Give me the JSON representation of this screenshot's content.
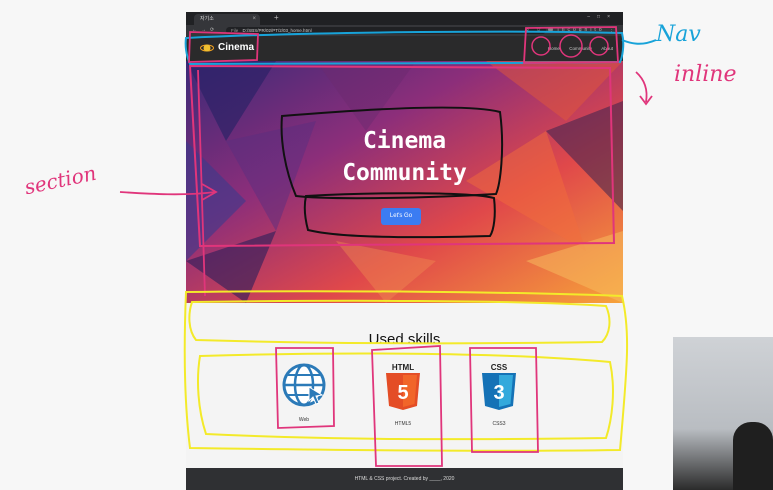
{
  "browser": {
    "tab_title": "자기소",
    "url_prefix": "File",
    "url": "D:/SBS/PR/02/PT/2/03_home.html",
    "profile_label": "Incognito"
  },
  "site": {
    "brand": "Cinema",
    "nav_links": [
      "Home",
      "Community",
      "About"
    ]
  },
  "hero": {
    "title_line1": "Cinema",
    "title_line2": "Community",
    "button_label": "Let's Go"
  },
  "skills": {
    "title": "Used skills",
    "items": [
      {
        "label": "Web",
        "icon": "globe-icon"
      },
      {
        "label": "HTML5",
        "icon": "html5-icon"
      },
      {
        "label": "CSS3",
        "icon": "css3-icon"
      }
    ]
  },
  "footer": {
    "text": "HTML & CSS project. Created by ____, 2020"
  },
  "annotations": {
    "nav": "Nav",
    "inline": "inline",
    "section": "section"
  },
  "colors": {
    "nav_annotation": "#18a3d9",
    "pink_annotation": "#e0357b",
    "yellow_annotation": "#f3ea2a",
    "button": "#3b7cf2"
  }
}
